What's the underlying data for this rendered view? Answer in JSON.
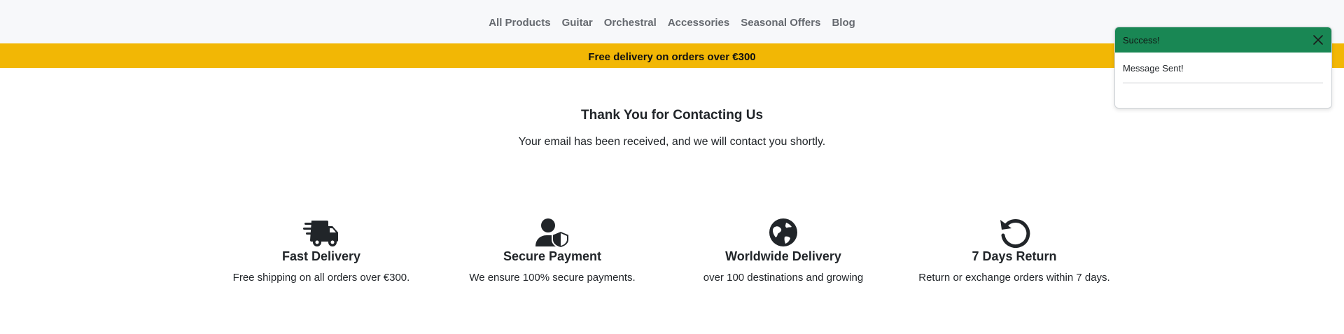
{
  "nav": {
    "items": [
      {
        "label": "All Products",
        "name": "nav-all-products"
      },
      {
        "label": "Guitar",
        "name": "nav-guitar"
      },
      {
        "label": "Orchestral",
        "name": "nav-orchestral"
      },
      {
        "label": "Accessories",
        "name": "nav-accessories"
      },
      {
        "label": "Seasonal Offers",
        "name": "nav-seasonal-offers"
      },
      {
        "label": "Blog",
        "name": "nav-blog"
      }
    ]
  },
  "banner": {
    "text": "Free delivery on orders over €300",
    "color": "#f2b705"
  },
  "confirmation": {
    "title": "Thank You for Contacting Us",
    "message": "Your email has been received, and we will contact you shortly."
  },
  "features": [
    {
      "icon": "delivery-truck-icon",
      "title": "Fast Delivery",
      "text": "Free shipping on all orders over €300."
    },
    {
      "icon": "user-shield-icon",
      "title": "Secure Payment",
      "text": "We ensure 100% secure payments."
    },
    {
      "icon": "globe-icon",
      "title": "Worldwide Delivery",
      "text": "over 100 destinations and growing"
    },
    {
      "icon": "rotate-left-icon",
      "title": "7 Days Return",
      "text": "Return or exchange orders within 7 days."
    }
  ],
  "toast": {
    "title": "Success!",
    "message": "Message Sent!",
    "header_color": "#198754",
    "close_icon": "close-icon"
  }
}
